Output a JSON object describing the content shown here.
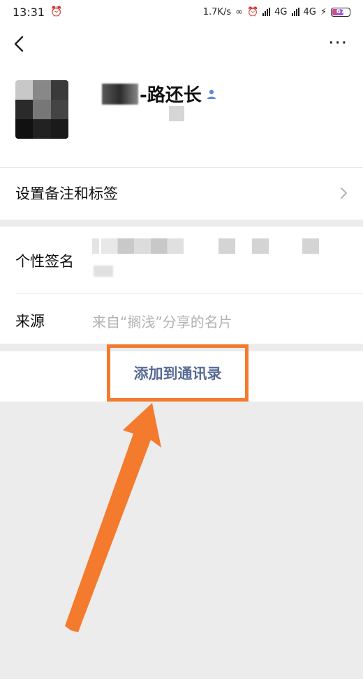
{
  "status_bar": {
    "time": "13:31",
    "net_speed": "1.7K/s",
    "network_1": "4G",
    "network_2": "4G",
    "battery": "67"
  },
  "profile": {
    "name_suffix": "-路还长"
  },
  "rows": {
    "remark_label": "设置备注和标签",
    "signature_label": "个性签名",
    "source_label": "来源",
    "source_value": "来自“搁浅”分享的名片"
  },
  "actions": {
    "add_contact": "添加到通讯录"
  },
  "colors": {
    "link": "#576b95",
    "highlight": "#f47a2e",
    "background": "#ececec"
  }
}
